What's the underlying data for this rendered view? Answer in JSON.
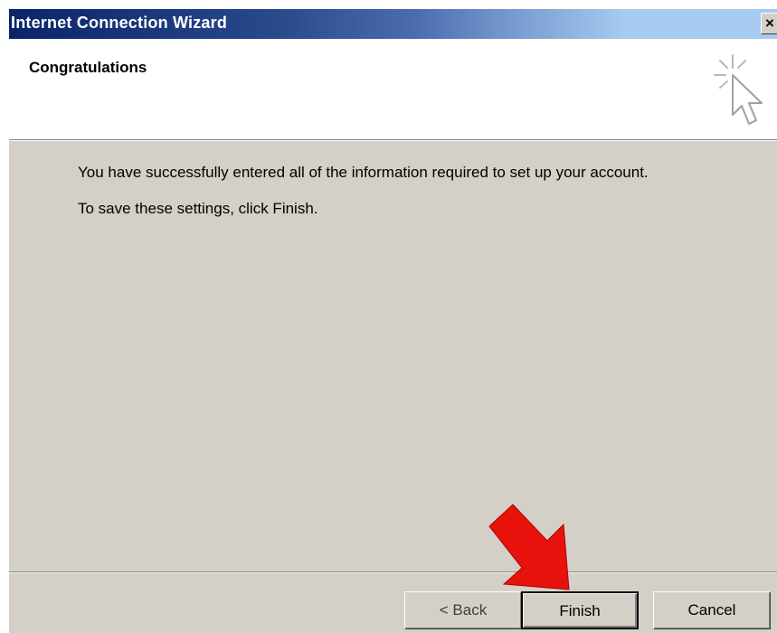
{
  "window": {
    "title": "Internet Connection Wizard",
    "close_label": "×"
  },
  "header": {
    "heading": "Congratulations",
    "icon": "wizard-sparkle-cursor-icon"
  },
  "content": {
    "line1": "You have successfully entered all of the information required to set up your account.",
    "line2": "To save these settings, click Finish."
  },
  "buttons": {
    "back_label": "< Back",
    "finish_label": "Finish",
    "cancel_label": "Cancel"
  },
  "annotation": {
    "icon": "red-arrow-icon",
    "color": "#e8120c"
  },
  "colors": {
    "titlebar_start": "#0a246a",
    "titlebar_end": "#a6caf0",
    "dialog_face": "#d4d0c8"
  }
}
